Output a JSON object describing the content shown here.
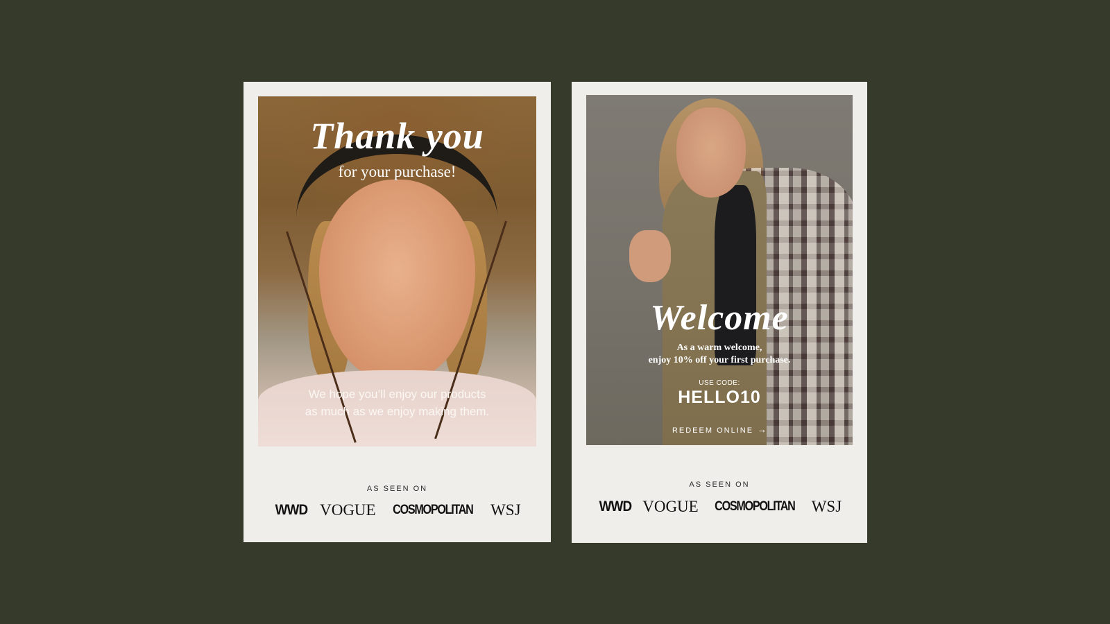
{
  "thank_you_card": {
    "title": "Thank you",
    "subtitle": "for your purchase!",
    "message_line1": "We hope you’ll enjoy our products",
    "message_line2": "as much as we enjoy making them.",
    "seen_on": "AS SEEN ON",
    "logos": [
      "WWD",
      "VOGUE",
      "COSMOPOLITAN",
      "WSJ"
    ]
  },
  "welcome_card": {
    "title": "Welcome",
    "subtitle_line1": "As a warm welcome,",
    "subtitle_line2": "enjoy 10% off your first purchase.",
    "code_label": "USE CODE:",
    "code": "HELLO10",
    "redeem": "REDEEM ONLINE",
    "arrow": "→",
    "arrow_icon": "arrow-right-icon",
    "seen_on": "AS SEEN ON",
    "logos": [
      "WWD",
      "VOGUE",
      "COSMOPOLITAN",
      "WSJ"
    ]
  },
  "colors": {
    "background": "#353a2b",
    "card": "#efeeea",
    "overlay_text": "#ffffff"
  }
}
